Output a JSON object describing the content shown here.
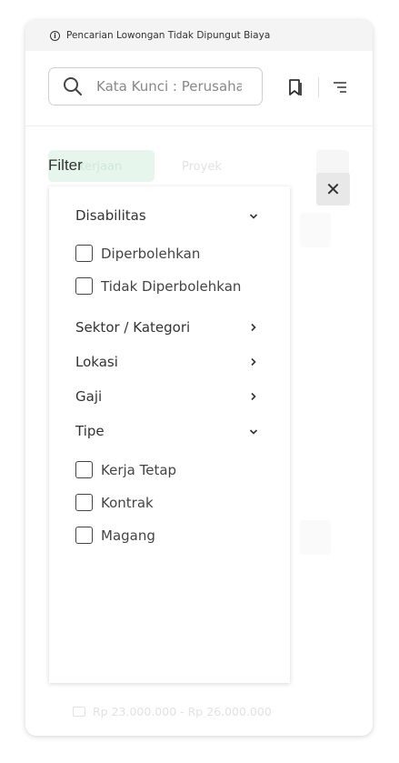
{
  "notice": {
    "text": "Pencarian Lowongan Tidak Dipungut Biaya"
  },
  "search": {
    "placeholder": "Kata Kunci : Perusahaan"
  },
  "tabs": {
    "active_partial": "kerjaan",
    "second": "Proyek"
  },
  "background_job": {
    "salary": "Rp 23.000.000 - Rp 26.000.000"
  },
  "filter": {
    "title": "Filter",
    "close_glyph": "✕",
    "sections": [
      {
        "label": "Disabilitas",
        "state": "expanded",
        "options": [
          "Diperbolehkan",
          "Tidak Diperbolehkan"
        ]
      },
      {
        "label": "Sektor / Kategori",
        "state": "collapsed"
      },
      {
        "label": "Lokasi",
        "state": "collapsed"
      },
      {
        "label": "Gaji",
        "state": "collapsed"
      },
      {
        "label": "Tipe",
        "state": "expanded",
        "options": [
          "Kerja Tetap",
          "Kontrak",
          "Magang"
        ]
      }
    ]
  },
  "colors": {
    "accent_green_light": "#e6f6ec",
    "text": "#333333",
    "border": "#cfcfcf"
  }
}
